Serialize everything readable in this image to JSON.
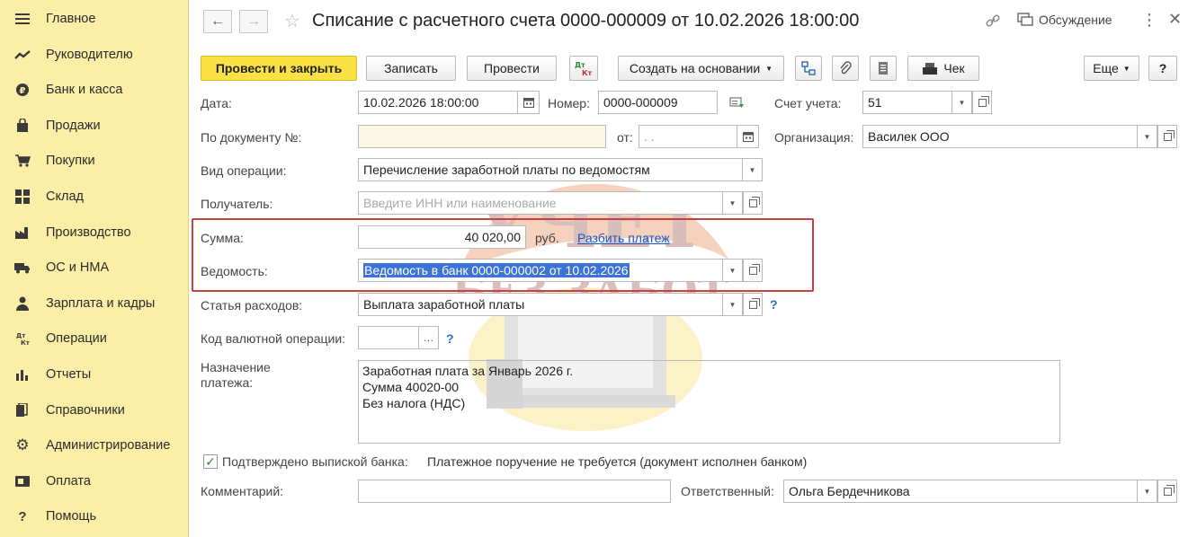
{
  "sidebar": {
    "items": [
      {
        "label": "Главное",
        "icon": "menu-icon"
      },
      {
        "label": "Руководителю",
        "icon": "trend-icon"
      },
      {
        "label": "Банк и касса",
        "icon": "coin-icon"
      },
      {
        "label": "Продажи",
        "icon": "bag-icon"
      },
      {
        "label": "Покупки",
        "icon": "cart-icon"
      },
      {
        "label": "Склад",
        "icon": "grid-icon"
      },
      {
        "label": "Производство",
        "icon": "factory-icon"
      },
      {
        "label": "ОС и НМА",
        "icon": "truck-icon"
      },
      {
        "label": "Зарплата и кадры",
        "icon": "person-icon"
      },
      {
        "label": "Операции",
        "icon": "dt-kt-icon"
      },
      {
        "label": "Отчеты",
        "icon": "bar-chart-icon"
      },
      {
        "label": "Справочники",
        "icon": "books-icon"
      },
      {
        "label": "Администрирование",
        "icon": "gear-icon"
      },
      {
        "label": "Оплата",
        "icon": "payment-icon"
      },
      {
        "label": "Помощь",
        "icon": "question-icon"
      }
    ]
  },
  "header": {
    "title": "Списание с расчетного счета 0000-000009 от 10.02.2026 18:00:00",
    "discussion_label": "Обсуждение"
  },
  "toolbar": {
    "post_close_label": "Провести и закрыть",
    "save_label": "Записать",
    "post_label": "Провести",
    "dtkt_label": "Дт Кт",
    "create_based_label": "Создать на основании",
    "check_label": "Чек",
    "more_label": "Еще",
    "help_label": "?"
  },
  "form": {
    "date_label": "Дата:",
    "date_value": "10.02.2026 18:00:00",
    "number_label": "Номер:",
    "number_value": "0000-000009",
    "account_label": "Счет учета:",
    "account_value": "51",
    "doc_no_label": "По документу №:",
    "doc_no_value": "",
    "from_label": "от:",
    "from_value": ".  .",
    "org_label": "Организация:",
    "org_value": "Василек ООО",
    "op_type_label": "Вид операции:",
    "op_type_value": "Перечисление заработной платы по ведомостям",
    "recipient_label": "Получатель:",
    "recipient_placeholder": "Введите ИНН или наименование",
    "sum_label": "Сумма:",
    "sum_value": "40 020,00",
    "currency_label": "руб.",
    "split_payment_label": "Разбить платеж",
    "statement_label": "Ведомость:",
    "statement_value": "Ведомость в банк 0000-000002 от 10.02.2026",
    "expense_label": "Статья расходов:",
    "expense_value": "Выплата заработной платы",
    "currency_op_label": "Код валютной операции:",
    "currency_op_value": "",
    "purpose_label": "Назначение\nплатежа:",
    "purpose_value": "Заработная плата за Январь 2026 г.\nСумма 40020-00\nБез налога (НДС)",
    "confirmed_label": "Подтверждено выпиской банка:",
    "confirmed_note": "Платежное поручение не требуется (документ исполнен банком)",
    "comment_label": "Комментарий:",
    "comment_value": "",
    "responsible_label": "Ответственный:",
    "responsible_value": "Ольга Бердечникова"
  },
  "watermark": {
    "line1": "УЧЕТ",
    "line2": "БЕЗ ЗАБОТ"
  },
  "colors": {
    "sidebar_bg": "#fbeea6",
    "primary_button": "#fbe244",
    "highlight_border": "#c94040",
    "selection": "#3d73d6",
    "link": "#1a55c4"
  }
}
